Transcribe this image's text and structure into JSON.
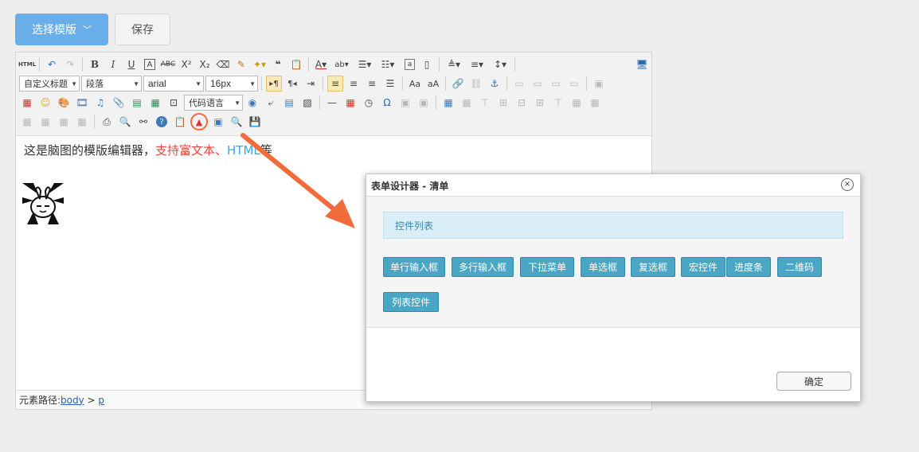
{
  "top": {
    "template_button": "选择模版",
    "template_chevron": "﹀",
    "save_button": "保存"
  },
  "toolbar": {
    "style_select": "自定义标题",
    "paragraph_select": "段落",
    "font_select": "arial",
    "size_select": "16px",
    "code_select": "代码语言"
  },
  "content": {
    "text_plain": "这是脑图的模版编辑器，",
    "text_red": "支持富文本、",
    "text_blue": "HTML",
    "text_end": "等"
  },
  "status": {
    "label": "元素路径: ",
    "link1": "body",
    "sep": " > ",
    "link2": "p"
  },
  "dialog": {
    "title": "表单设计器 - 清单",
    "close": "×",
    "notice": "控件列表",
    "controls": [
      "单行输入框",
      "多行输入框",
      "下拉菜单",
      "单选框",
      "复选框",
      "宏控件",
      "进度条",
      "二维码",
      "列表控件"
    ],
    "ok": "确定"
  },
  "colors": {
    "primary": "#6aaee9",
    "control": "#4aa6c5",
    "arrow": "#f26b3a",
    "red_text": "#e8453c",
    "blue_text": "#3aa9e0"
  }
}
